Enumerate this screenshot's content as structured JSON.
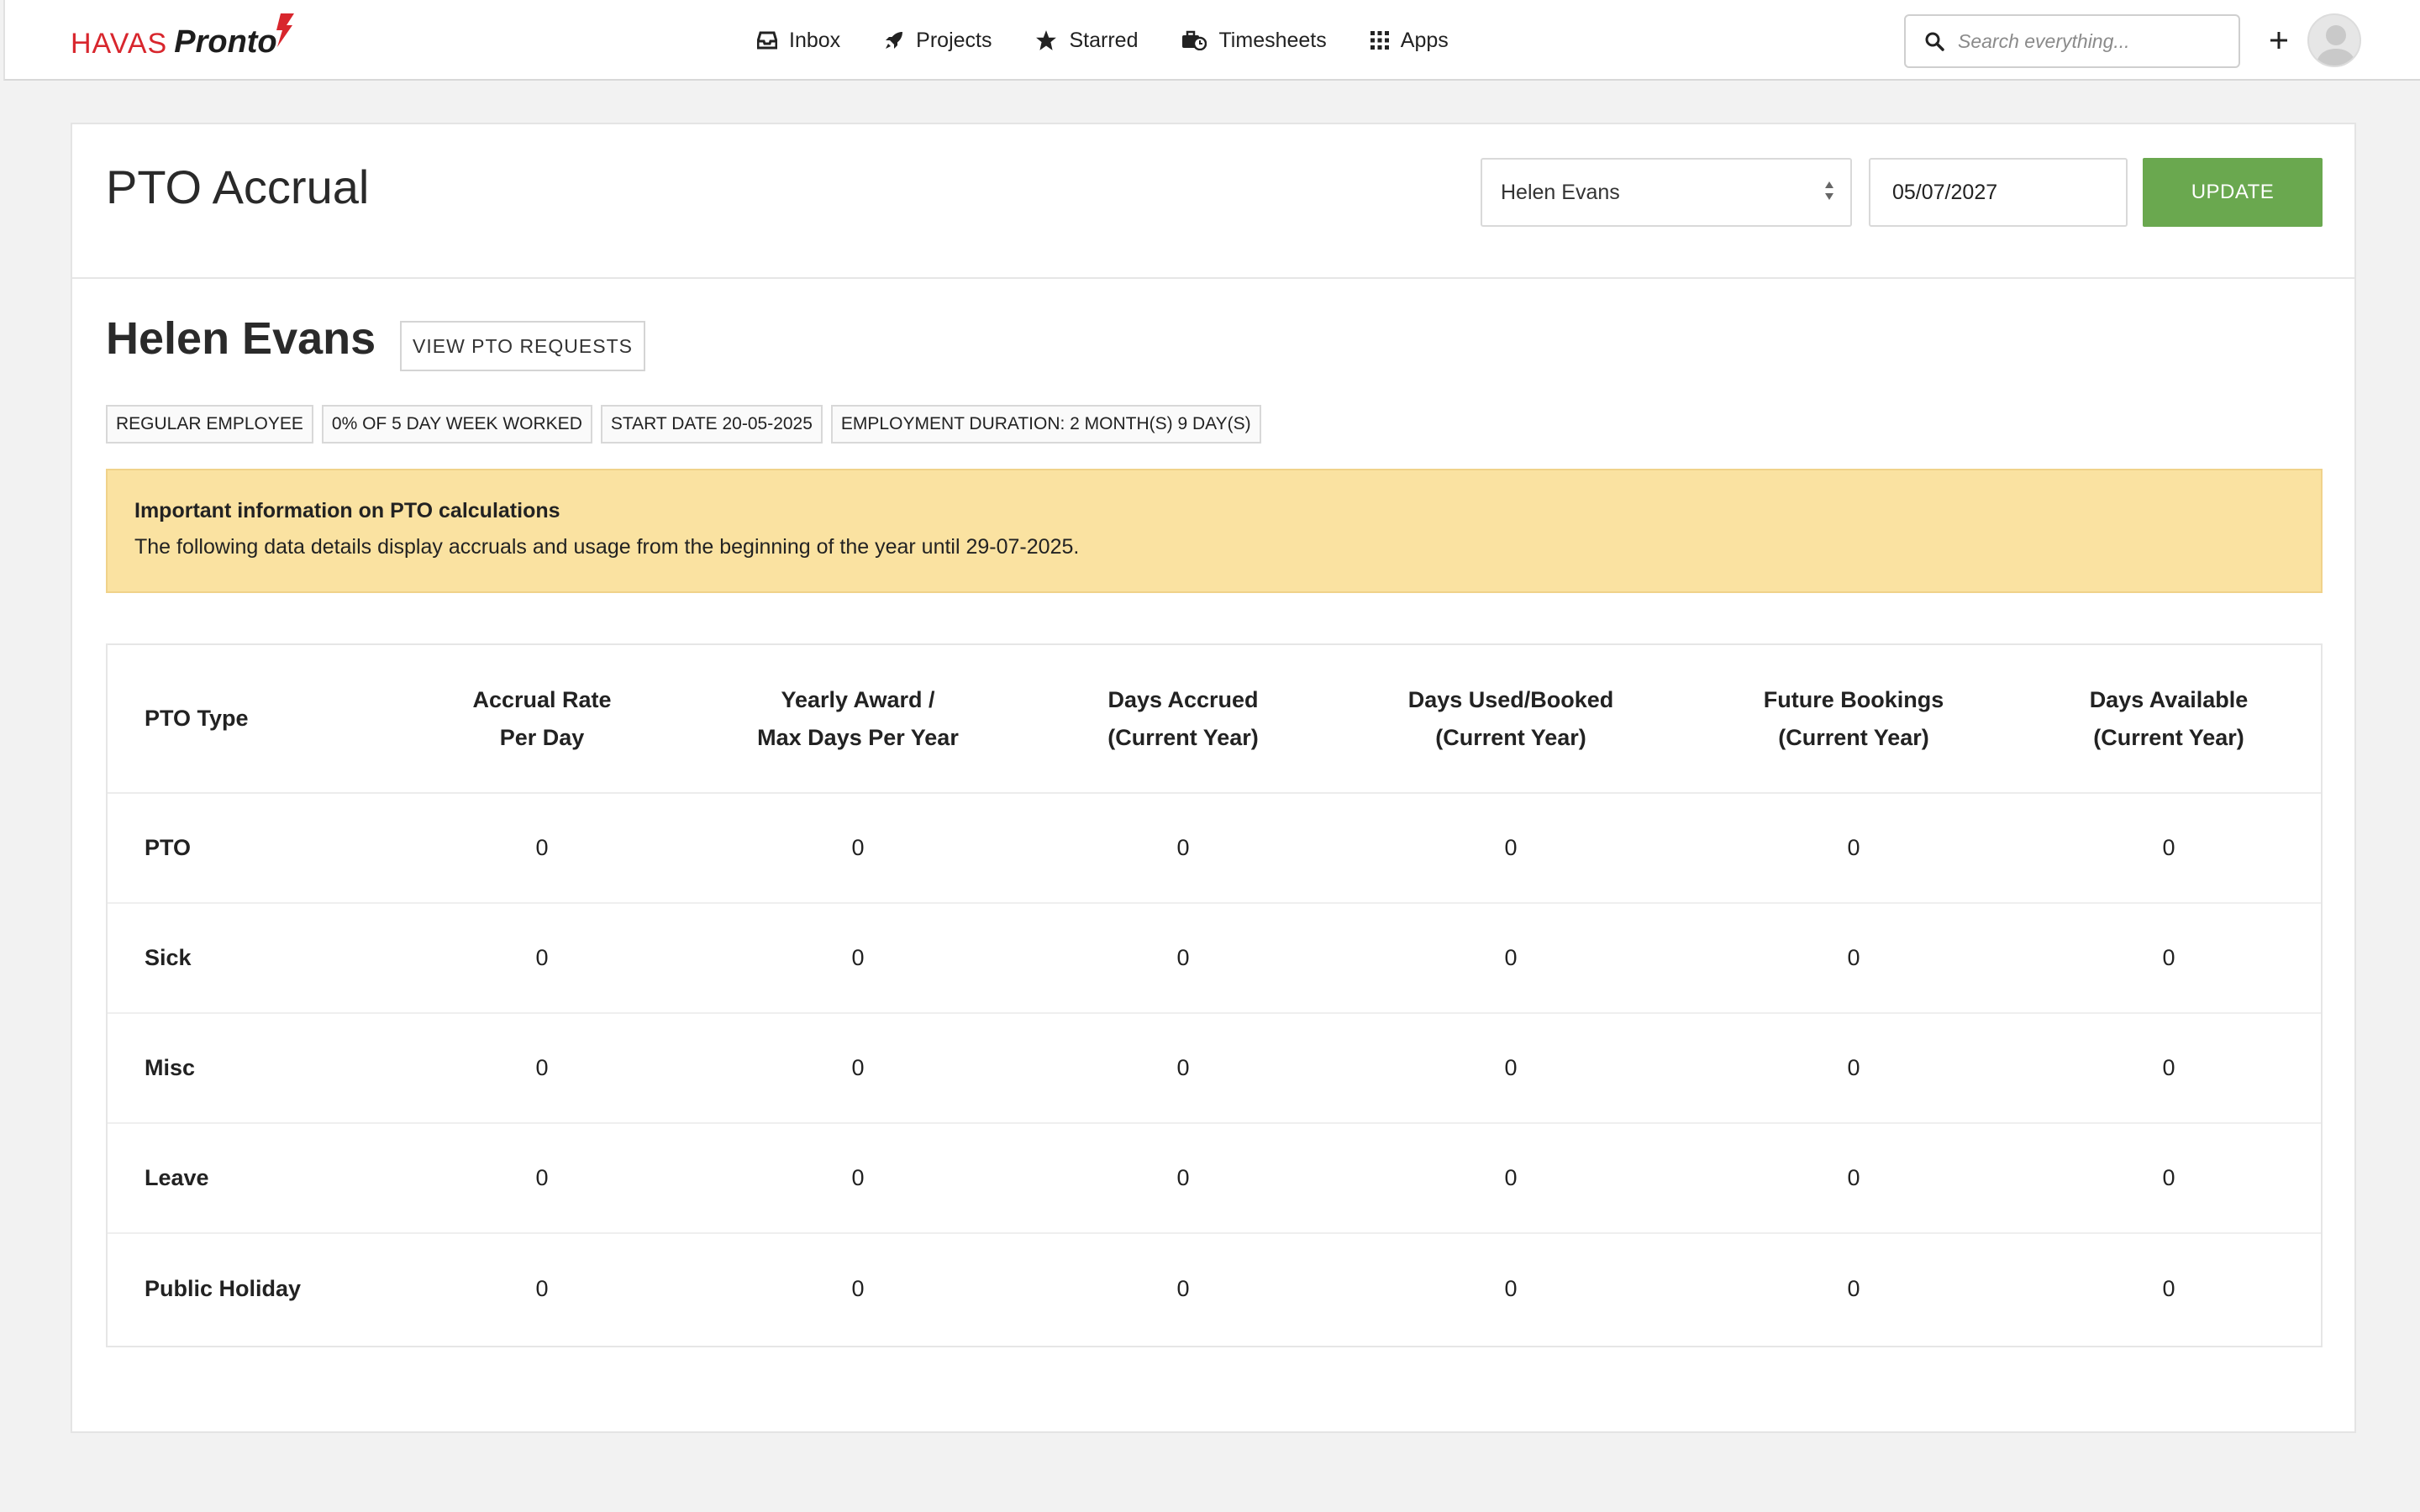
{
  "brand": {
    "name_left": "HAVAS",
    "name_right": "Pronto"
  },
  "nav": [
    {
      "label": "Inbox",
      "icon": "inbox-icon"
    },
    {
      "label": "Projects",
      "icon": "rocket-icon"
    },
    {
      "label": "Starred",
      "icon": "star-icon"
    },
    {
      "label": "Timesheets",
      "icon": "timesheets-icon"
    },
    {
      "label": "Apps",
      "icon": "apps-grid-icon"
    }
  ],
  "search": {
    "placeholder": "Search everything..."
  },
  "page": {
    "title": "PTO Accrual"
  },
  "filters": {
    "employee": "Helen Evans",
    "date": "05/07/2027",
    "update_label": "UPDATE"
  },
  "employee": {
    "name": "Helen Evans",
    "view_requests_label": "VIEW PTO REQUESTS",
    "badges": [
      "REGULAR EMPLOYEE",
      "0% OF 5 DAY WEEK WORKED",
      "START DATE 20-05-2025",
      "EMPLOYMENT DURATION: 2 MONTH(S) 9 DAY(S)"
    ]
  },
  "notice": {
    "title": "Important information on PTO calculations",
    "text": "The following data details display accruals and usage from the beginning of the year until 29-07-2025."
  },
  "table": {
    "headers": [
      [
        "PTO Type"
      ],
      [
        "Accrual Rate",
        "Per Day"
      ],
      [
        "Yearly Award /",
        "Max Days Per Year"
      ],
      [
        "Days Accrued",
        "(Current Year)"
      ],
      [
        "Days Used/Booked",
        "(Current Year)"
      ],
      [
        "Future Bookings",
        "(Current Year)"
      ],
      [
        "Days Available",
        "(Current Year)"
      ]
    ],
    "rows": [
      [
        "PTO",
        "0",
        "0",
        "0",
        "0",
        "0",
        "0"
      ],
      [
        "Sick",
        "0",
        "0",
        "0",
        "0",
        "0",
        "0"
      ],
      [
        "Misc",
        "0",
        "0",
        "0",
        "0",
        "0",
        "0"
      ],
      [
        "Leave",
        "0",
        "0",
        "0",
        "0",
        "0",
        "0"
      ],
      [
        "Public Holiday",
        "0",
        "0",
        "0",
        "0",
        "0",
        "0"
      ]
    ]
  },
  "colors": {
    "accent_green": "#6aa84f",
    "notice_bg": "#fae2a1",
    "brand_red": "#d8262d"
  }
}
